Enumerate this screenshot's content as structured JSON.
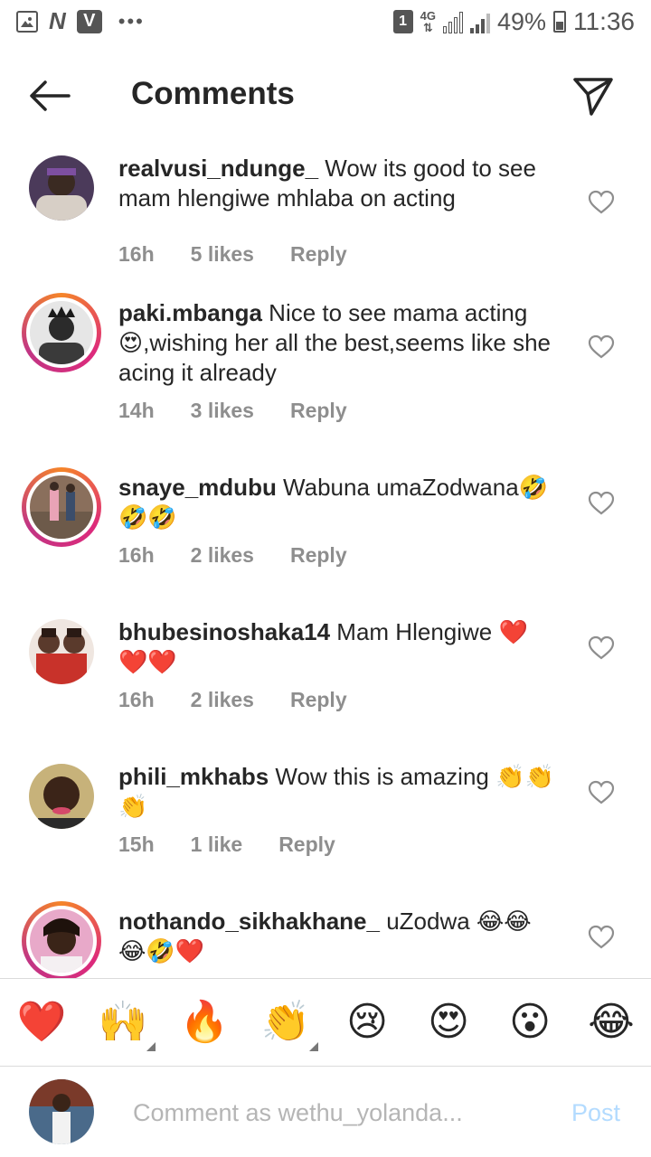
{
  "status_bar": {
    "sim": "1",
    "network": "4G",
    "battery": "49%",
    "time": "11:36",
    "left_icons": [
      "image-icon",
      "n-icon",
      "v-icon"
    ]
  },
  "header": {
    "title": "Comments"
  },
  "comments": [
    {
      "user": "realvusi_ndunge_",
      "text": " Wow its good to see mam hlengiwe mhlaba on acting",
      "time": "16h",
      "likes": "5 likes",
      "reply": "Reply",
      "story_ring": false
    },
    {
      "user": "paki.mbanga",
      "text": " Nice to see mama acting 😍,wishing her all the best,seems like she acing it already",
      "time": "14h",
      "likes": "3 likes",
      "reply": "Reply",
      "story_ring": true
    },
    {
      "user": "snaye_mdubu",
      "text": " Wabuna umaZodwana🤣🤣🤣",
      "time": "16h",
      "likes": "2 likes",
      "reply": "Reply",
      "story_ring": true
    },
    {
      "user": "bhubesinoshaka14",
      "text": " Mam Hlengiwe ❤️❤️❤️",
      "time": "16h",
      "likes": "2 likes",
      "reply": "Reply",
      "story_ring": false
    },
    {
      "user": "phili_mkhabs",
      "text": " Wow this is amazing 👏👏👏",
      "time": "15h",
      "likes": "1 like",
      "reply": "Reply",
      "story_ring": false
    },
    {
      "user": "nothando_sikhakhane_",
      "text": " uZodwa 😂😂😂🤣❤️",
      "time": "",
      "likes": "",
      "reply": "",
      "story_ring": true
    }
  ],
  "emoji_bar": [
    "❤️",
    "🙌",
    "🔥",
    "👏",
    "😢",
    "😍",
    "😮",
    "😂"
  ],
  "composer": {
    "placeholder": "Comment as wethu_yolanda...",
    "post_label": "Post"
  },
  "colors": {
    "text": "#262626",
    "meta": "#8e8e8e",
    "post_disabled": "#b3dbff",
    "ring_start": "#f58529",
    "ring_end": "#dd2a7b"
  }
}
